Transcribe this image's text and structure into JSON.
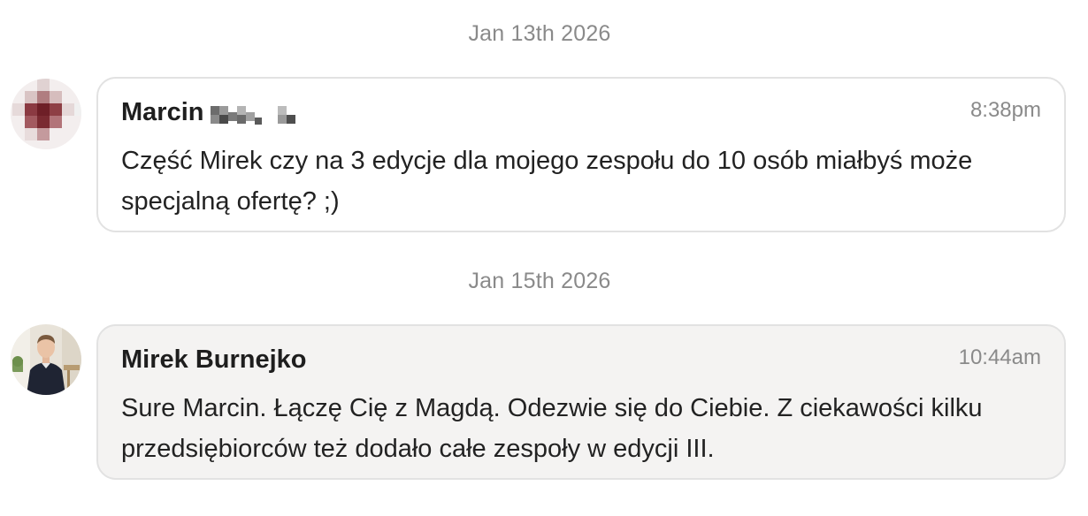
{
  "conversation": {
    "messages": [
      {
        "date": "Jan 13th 2026",
        "sender": "Marcin",
        "sender_surname_redacted": true,
        "time": "8:38pm",
        "text": "Część Mirek czy na 3 edycje dla mojego zespołu do 10 osób miałbyś może specjalną ofertę? ;)"
      },
      {
        "date": "Jan 15th 2026",
        "sender": "Mirek Burnejko",
        "time": "10:44am",
        "text": "Sure Marcin. Łączę Cię z Magdą. Odezwie się do Ciebie. Z ciekawości kilku przedsiębiorców też dodało całe zespoły w edycji III."
      }
    ]
  },
  "colors": {
    "date_text": "#8a8a8a",
    "bubble_border": "#e2e2e2",
    "incoming_bg": "#ffffff",
    "outgoing_bg": "#f4f3f2"
  }
}
